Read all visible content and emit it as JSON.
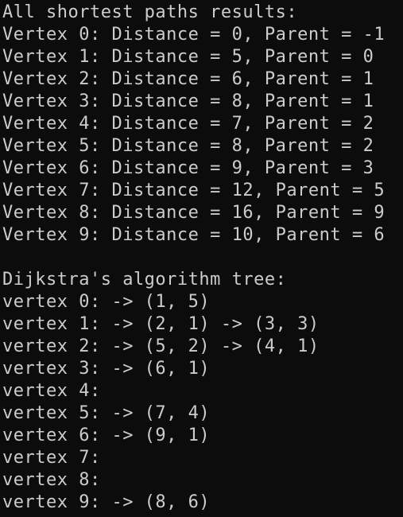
{
  "console": {
    "paths_header": "All shortest paths results:",
    "paths": [
      "Vertex 0: Distance = 0, Parent = -1",
      "Vertex 1: Distance = 5, Parent = 0",
      "Vertex 2: Distance = 6, Parent = 1",
      "Vertex 3: Distance = 8, Parent = 1",
      "Vertex 4: Distance = 7, Parent = 2",
      "Vertex 5: Distance = 8, Parent = 2",
      "Vertex 6: Distance = 9, Parent = 3",
      "Vertex 7: Distance = 12, Parent = 5",
      "Vertex 8: Distance = 16, Parent = 9",
      "Vertex 9: Distance = 10, Parent = 6"
    ],
    "tree_header": "Dijkstra's algorithm tree:",
    "tree": [
      "vertex 0: -> (1, 5)",
      "vertex 1: -> (2, 1) -> (3, 3)",
      "vertex 2: -> (5, 2) -> (4, 1)",
      "vertex 3: -> (6, 1)",
      "vertex 4:",
      "vertex 5: -> (7, 4)",
      "vertex 6: -> (9, 1)",
      "vertex 7:",
      "vertex 8:",
      "vertex 9: -> (8, 6)"
    ]
  },
  "colors": {
    "background": "#0c0c0c",
    "text": "#cccccc"
  }
}
